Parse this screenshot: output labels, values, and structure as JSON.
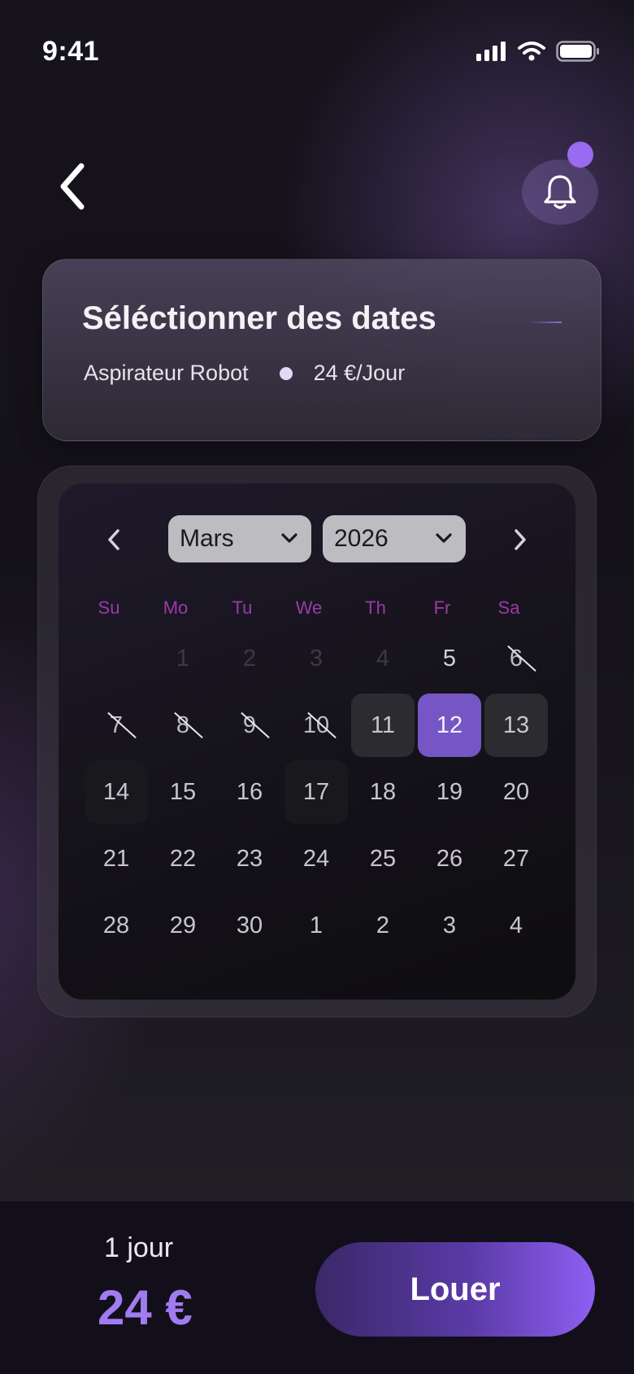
{
  "status_bar": {
    "time": "9:41"
  },
  "header": {
    "title": "Séléctionner des dates",
    "product": "Aspirateur Robot",
    "rate": "24 €/Jour"
  },
  "calendar": {
    "month": "Mars",
    "year": "2026",
    "weekdays": [
      "Su",
      "Mo",
      "Tu",
      "We",
      "Th",
      "Fr",
      "Sa"
    ],
    "weeks": [
      [
        "",
        "1",
        "2",
        "3",
        "4",
        "5",
        "6"
      ],
      [
        "7",
        "8",
        "9",
        "10",
        "11",
        "12",
        "13"
      ],
      [
        "14",
        "15",
        "16",
        "17",
        "18",
        "19",
        "20"
      ],
      [
        "21",
        "22",
        "23",
        "24",
        "25",
        "26",
        "27"
      ],
      [
        "28",
        "29",
        "30",
        "1",
        "2",
        "3",
        "4"
      ]
    ],
    "selected_day": "12",
    "unavailable_days": [
      "6",
      "7",
      "8",
      "9",
      "10"
    ]
  },
  "footer": {
    "duration": "1 jour",
    "total": "24 €",
    "rent_label": "Louer"
  },
  "colors": {
    "accent": "#7556c4",
    "price": "#a07cf0",
    "weekday": "#9b3aa8"
  }
}
